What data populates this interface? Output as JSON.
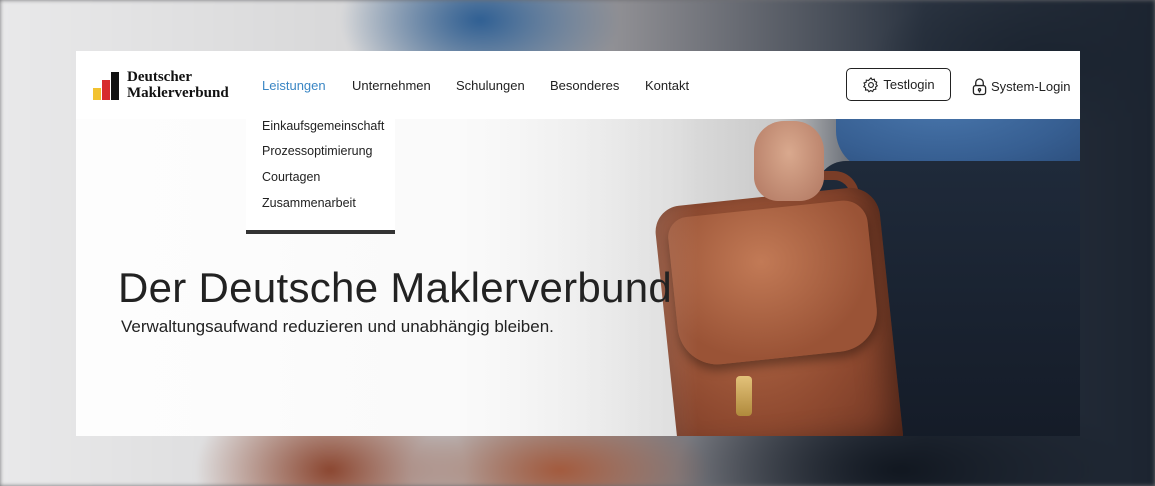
{
  "brand": {
    "line1": "Deutscher",
    "line2": "Maklerverbund",
    "colors": [
      "#f2c230",
      "#d72d2d",
      "#111111"
    ]
  },
  "nav": {
    "items": [
      {
        "label": "Leistungen",
        "active": true
      },
      {
        "label": "Unternehmen",
        "active": false
      },
      {
        "label": "Schulungen",
        "active": false
      },
      {
        "label": "Besonderes",
        "active": false
      },
      {
        "label": "Kontakt",
        "active": false
      }
    ],
    "active_color": "#3a86c4"
  },
  "dropdown": {
    "items": [
      "Einkaufsgemeinschaft",
      "Prozessoptimierung",
      "Courtagen",
      "Zusammenarbeit"
    ]
  },
  "actions": {
    "testlogin": {
      "label": "Testlogin",
      "icon": "gear-icon"
    },
    "syslogin": {
      "label": "System-Login",
      "icon": "lock-icon"
    }
  },
  "hero": {
    "title": "Der Deutsche Maklerverbund",
    "subtitle": "Verwaltungsaufwand reduzieren und unabhängig bleiben."
  }
}
